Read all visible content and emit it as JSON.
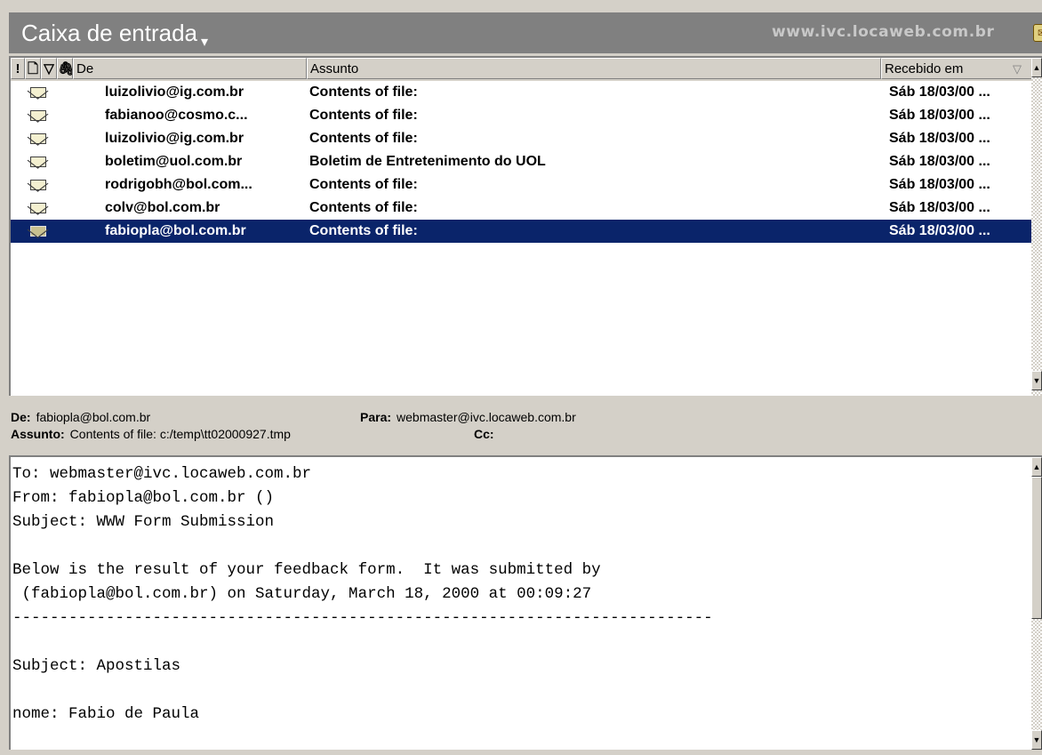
{
  "window": {
    "title": "Caixa de entrada",
    "title_caret": "▾",
    "url": "www.ivc.locaweb.com.br"
  },
  "list": {
    "columns": {
      "importance": "!",
      "icon": "🗋",
      "flag": "▽",
      "attachment": "🖇",
      "from": "De",
      "subject": "Assunto",
      "received": "Recebido em"
    },
    "rows": [
      {
        "from": "luizolivio@ig.com.br",
        "subject": "Contents of file:",
        "received": "Sáb 18/03/00 ...",
        "icon": "envelope-icon",
        "selected": false
      },
      {
        "from": "fabianoo@cosmo.c...",
        "subject": "Contents of file:",
        "received": "Sáb 18/03/00 ...",
        "icon": "envelope-icon",
        "selected": false
      },
      {
        "from": "luizolivio@ig.com.br",
        "subject": "Contents of file:",
        "received": "Sáb 18/03/00 ...",
        "icon": "envelope-icon",
        "selected": false
      },
      {
        "from": "boletim@uol.com.br",
        "subject": "Boletim de Entretenimento do UOL",
        "received": "Sáb 18/03/00 ...",
        "icon": "envelope-icon",
        "selected": false
      },
      {
        "from": "rodrigobh@bol.com...",
        "subject": "Contents of file:",
        "received": "Sáb 18/03/00 ...",
        "icon": "envelope-icon",
        "selected": false
      },
      {
        "from": "colv@bol.com.br",
        "subject": "Contents of file:",
        "received": "Sáb 18/03/00 ...",
        "icon": "envelope-icon",
        "selected": false
      },
      {
        "from": "fabiopla@bol.com.br",
        "subject": "Contents of file:",
        "received": "Sáb 18/03/00 ...",
        "icon": "envelope-icon",
        "selected": true
      }
    ]
  },
  "preview": {
    "from_label": "De:",
    "from_value": "fabiopla@bol.com.br",
    "to_label": "Para:",
    "to_value": "webmaster@ivc.locaweb.com.br",
    "subject_label": "Assunto:",
    "subject_value": "Contents of file: c:/temp\\tt02000927.tmp",
    "cc_label": "Cc:",
    "cc_value": ""
  },
  "body": {
    "lines": [
      "To: webmaster@ivc.locaweb.com.br",
      "From: fabiopla@bol.com.br ()",
      "Subject: WWW Form Submission",
      "",
      "Below is the result of your feedback form.  It was submitted by",
      " (fabiopla@bol.com.br) on Saturday, March 18, 2000 at 00:09:27",
      "---------------------------------------------------------------------------",
      "",
      "Subject: Apostilas",
      "",
      "nome: Fabio de Paula"
    ]
  },
  "colors": {
    "selection": "#0a246a",
    "chrome": "#d4d0c8",
    "title_bar": "#808080"
  }
}
